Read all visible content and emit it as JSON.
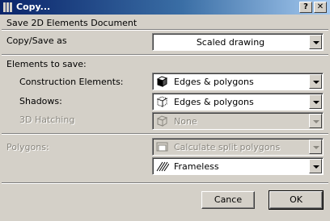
{
  "window": {
    "title": "Copy...",
    "help_label": "?",
    "close_label": "✕",
    "app_icon": "app-icon"
  },
  "heading": "Save 2D Elements Document",
  "copy_save_as": {
    "label": "Copy/Save as",
    "value": "Scaled drawing"
  },
  "elements_to_save": {
    "label": "Elements to save:",
    "construction": {
      "label": "Construction Elements:",
      "value": "Edges & polygons",
      "icon": "cube-solid-icon"
    },
    "shadows": {
      "label": "Shadows:",
      "value": "Edges & polygons",
      "icon": "cube-dotted-icon"
    },
    "hatching_3d": {
      "label": "3D Hatching",
      "value": "None",
      "icon": "hatch-icon"
    }
  },
  "polygons": {
    "label": "Polygons:",
    "calc_value": "Calculate split polygons",
    "calc_icon": "split-polygon-icon",
    "frame_value": "Frameless",
    "frame_icon": "hatch-pattern-icon"
  },
  "buttons": {
    "cancel": "Cance",
    "ok": "OK"
  }
}
